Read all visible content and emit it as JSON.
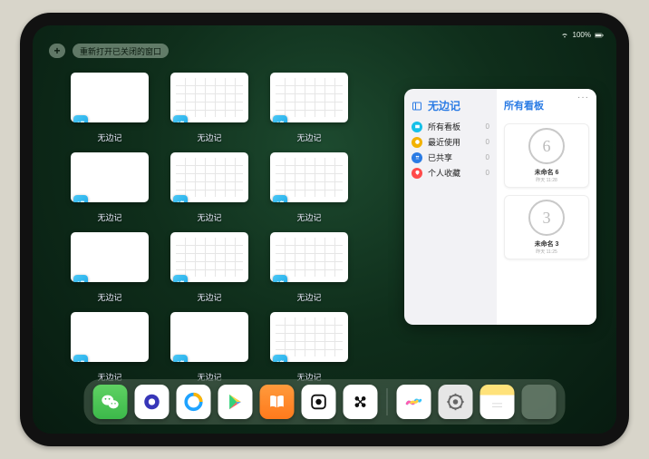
{
  "status": {
    "battery": "100%"
  },
  "topbar": {
    "plus_label": "+",
    "reopen_label": "重新打开已关闭的窗口"
  },
  "windows": [
    {
      "label": "无边记",
      "variant": "blank"
    },
    {
      "label": "无边记",
      "variant": "calendar"
    },
    {
      "label": "无边记",
      "variant": "calendar"
    },
    {
      "label": "无边记",
      "variant": "blank"
    },
    {
      "label": "无边记",
      "variant": "calendar"
    },
    {
      "label": "无边记",
      "variant": "calendar"
    },
    {
      "label": "无边记",
      "variant": "blank"
    },
    {
      "label": "无边记",
      "variant": "calendar"
    },
    {
      "label": "无边记",
      "variant": "calendar"
    },
    {
      "label": "无边记",
      "variant": "blank"
    },
    {
      "label": "无边记",
      "variant": "blank"
    },
    {
      "label": "无边记",
      "variant": "calendar"
    }
  ],
  "popover": {
    "left_title": "无边记",
    "menu": [
      {
        "label": "所有看板",
        "count": "0",
        "color": "#15c0e8"
      },
      {
        "label": "最近使用",
        "count": "0",
        "color": "#f2b200"
      },
      {
        "label": "已共享",
        "count": "0",
        "color": "#2a7be4"
      },
      {
        "label": "个人收藏",
        "count": "0",
        "color": "#ff4a4a"
      }
    ],
    "right_title": "所有看板",
    "ellipsis": "···",
    "boards": [
      {
        "glyph": "6",
        "title": "未命名 6",
        "sub": "昨天 11:28"
      },
      {
        "glyph": "3",
        "title": "未命名 3",
        "sub": "昨天 11:25"
      }
    ]
  },
  "dock": {
    "icons": [
      {
        "name": "wechat-icon"
      },
      {
        "name": "quark-icon"
      },
      {
        "name": "qq-browser-icon"
      },
      {
        "name": "play-store-icon"
      },
      {
        "name": "books-icon"
      },
      {
        "name": "game-icon"
      },
      {
        "name": "camera-connect-icon"
      },
      {
        "name": "freeform-icon"
      },
      {
        "name": "settings-icon"
      },
      {
        "name": "notes-icon"
      },
      {
        "name": "app-library-icon"
      }
    ]
  }
}
